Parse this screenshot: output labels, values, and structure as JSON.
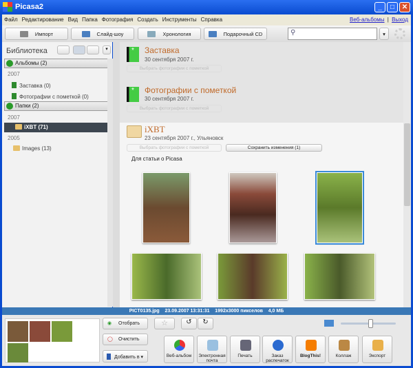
{
  "window": {
    "title": "Picasa2"
  },
  "menu": [
    "Файл",
    "Редактирование",
    "Вид",
    "Папка",
    "Фотография",
    "Создать",
    "Инструменты",
    "Справка"
  ],
  "menu_links": {
    "web": "Веб-альбомы",
    "sep": "|",
    "exit": "Выход"
  },
  "toolbar": {
    "import": "Импорт",
    "slideshow": "Слайд-шоу",
    "timeline": "Хронология",
    "giftcd": "Подарочный CD",
    "search_placeholder": ""
  },
  "library": {
    "title": "Библиотека",
    "albums_group": "Альбомы (2)",
    "albums_year": "2007",
    "albums": [
      "Заставка (0)",
      "Фотографии с пометкой (0)"
    ],
    "folders_group": "Папки (2)",
    "year1": "2007",
    "folder1": "iXBT (71)",
    "year2": "2005",
    "folder2": "Images (13)"
  },
  "main": {
    "albums": [
      {
        "title": "Заставка",
        "date": "30 сентября 2007 г.",
        "pick": "Выбрать фотографии с пометкой"
      },
      {
        "title": "Фотографии с пометкой",
        "date": "30 сентября 2007 г.",
        "pick": "Выбрать фотографии с пометкой"
      }
    ],
    "folder": {
      "title": "iXBT",
      "date": "23 сентября 2007 г., Ульяновск",
      "pick": "Выбрать фотографии с пометкой",
      "save": "Сохранить изменения (1)",
      "caption": "Для статьи о Picasa"
    }
  },
  "status": {
    "file": "PICT0135.jpg",
    "datetime": "23.09.2007 13:31:31",
    "dims": "1992x3000 пикселов",
    "size": "4,0 МБ"
  },
  "bottom": {
    "hold": "Отобрать",
    "clear": "Очистить",
    "add": "Добавить в ▾",
    "actions": [
      "Веб-альбом",
      "Электронная почта",
      "Печать",
      "Заказ распечаток",
      "BlogThis!",
      "Коллаж",
      "Экспорт"
    ],
    "zoom_level": 0.55
  }
}
